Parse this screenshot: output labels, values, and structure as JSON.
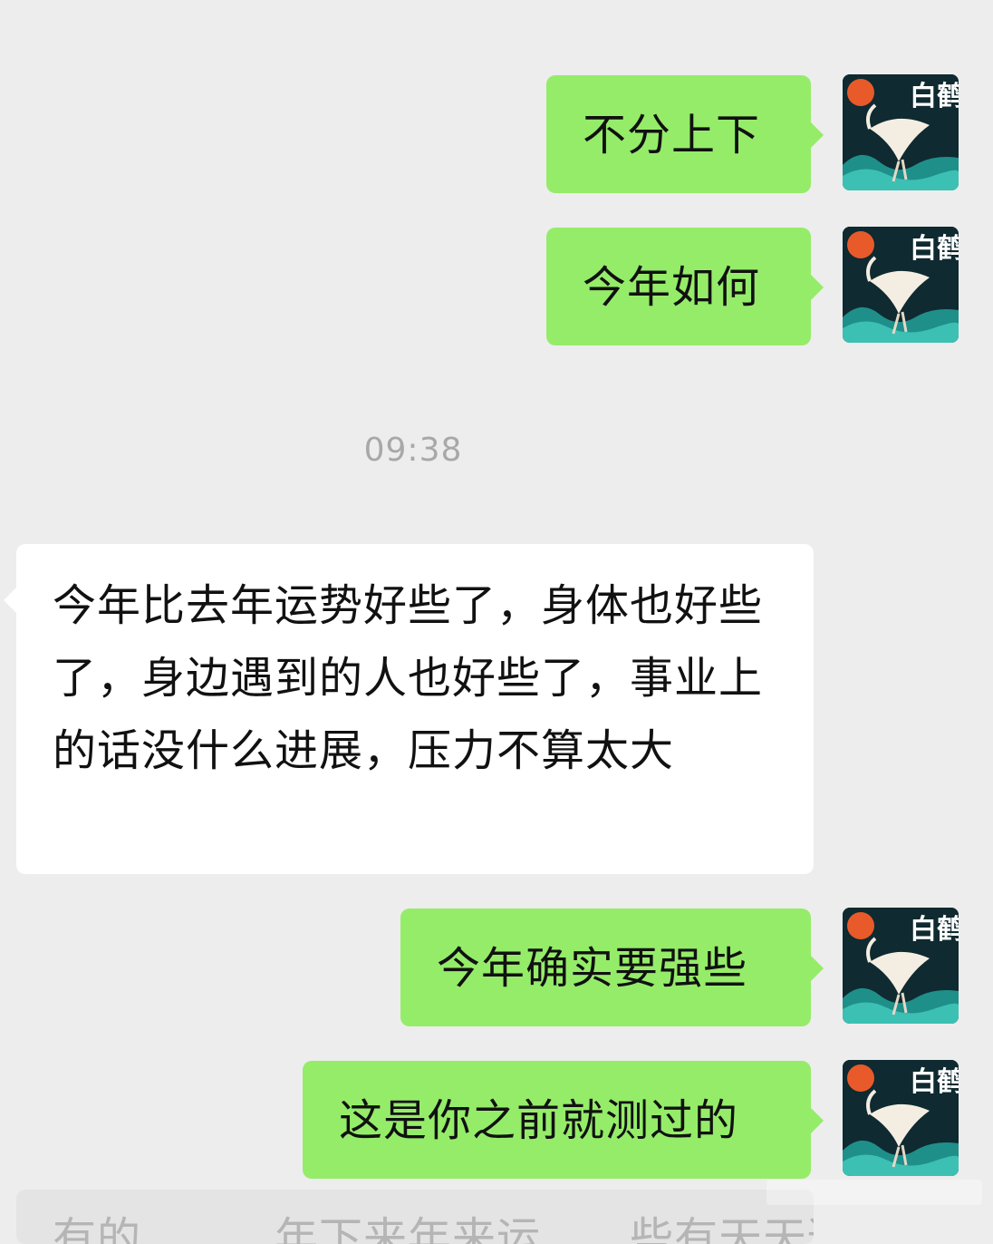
{
  "messages": [
    {
      "sender": "me",
      "text": "不分上下"
    },
    {
      "sender": "me",
      "text": "今年如何"
    },
    {
      "type": "timestamp",
      "text": "09:38"
    },
    {
      "sender": "other",
      "text": "今年比去年运势好些了，身体也好些了，身边遇到的人也好些了，事业上的话没什么进展，压力不算太大"
    },
    {
      "sender": "me",
      "text": "今年确实要强些"
    },
    {
      "sender": "me",
      "text": "这是你之前就测过的"
    }
  ],
  "partial_message": {
    "text": "有的　　　年下来年来运　　些有天天适"
  },
  "avatar": {
    "label": "白鹤",
    "icon": "crane-avatar-icon"
  },
  "colors": {
    "background": "#ededed",
    "outgoing_bubble": "#95ec69",
    "incoming_bubble": "#ffffff",
    "timestamp_text": "#a8a8a8"
  }
}
